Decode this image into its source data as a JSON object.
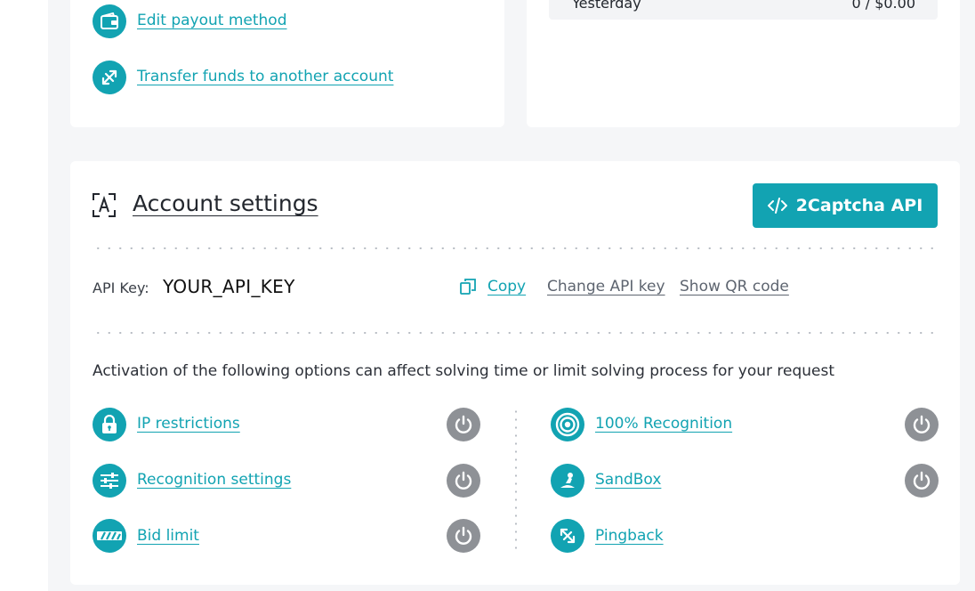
{
  "top_left_actions": [
    {
      "label": "Edit payout method",
      "icon": "wallet-icon"
    },
    {
      "label": "Transfer funds to another account",
      "icon": "transfer-icon"
    }
  ],
  "stats": {
    "yesterday_label": "Yesterday",
    "yesterday_value": "0 / $0.00"
  },
  "settings": {
    "title": "Account settings",
    "title_icon": "account-scan-icon",
    "api_button_label": "2Captcha API",
    "api_button_icon": "code-icon",
    "api_key_label": "API Key:",
    "api_key_value": "YOUR_API_KEY",
    "copy_label": "Copy",
    "change_key_label": "Change API key",
    "show_qr_label": "Show QR code",
    "notice": "Activation of the following options can affect solving time or limit solving process for your request"
  },
  "options_left": [
    {
      "label": "IP restrictions",
      "icon": "lock-icon",
      "enabled": false
    },
    {
      "label": "Recognition settings",
      "icon": "sliders-icon",
      "enabled": false
    },
    {
      "label": "Bid limit",
      "icon": "bid-limit-icon",
      "enabled": false
    }
  ],
  "options_right": [
    {
      "label": "100% Recognition",
      "icon": "target-icon",
      "enabled": false
    },
    {
      "label": "SandBox",
      "icon": "sandbox-icon",
      "enabled": false
    },
    {
      "label": "Pingback",
      "icon": "pingback-icon"
    }
  ],
  "colors": {
    "accent": "#12a3b2",
    "toggle_off": "#8e9196",
    "background": "#f5f6f8"
  }
}
